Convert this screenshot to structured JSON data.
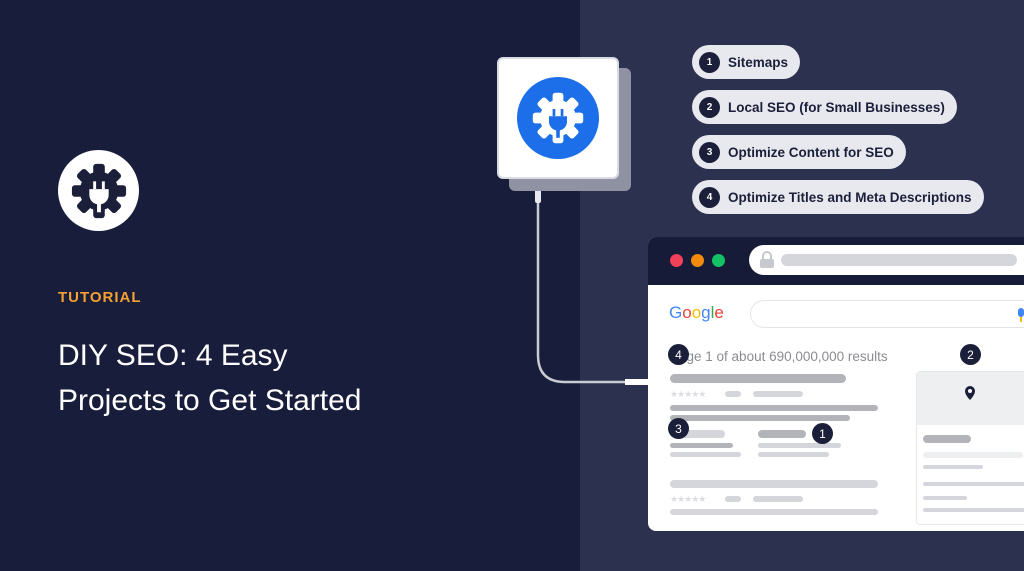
{
  "label": "TUTORIAL",
  "title_lines": [
    "DIY SEO: 4 Easy",
    "Projects to Get Started"
  ],
  "colors": {
    "background": "#181d3b",
    "panel": "#2c3150",
    "accent": "#f5a030",
    "plugin_blue": "#1c6fe8"
  },
  "icons": {
    "logo": "gear-plug-icon",
    "plugin": "gear-plug-icon"
  },
  "projects": [
    {
      "num": "1",
      "label": "Sitemaps"
    },
    {
      "num": "2",
      "label": "Local SEO (for Small Businesses)"
    },
    {
      "num": "3",
      "label": "Optimize Content for SEO"
    },
    {
      "num": "4",
      "label": "Optimize Titles and Meta Descriptions"
    }
  ],
  "browser": {
    "logo": "Google",
    "results_text": "Page 1 of about 690,000,000 results",
    "markers": [
      "1",
      "2",
      "3",
      "4"
    ]
  }
}
